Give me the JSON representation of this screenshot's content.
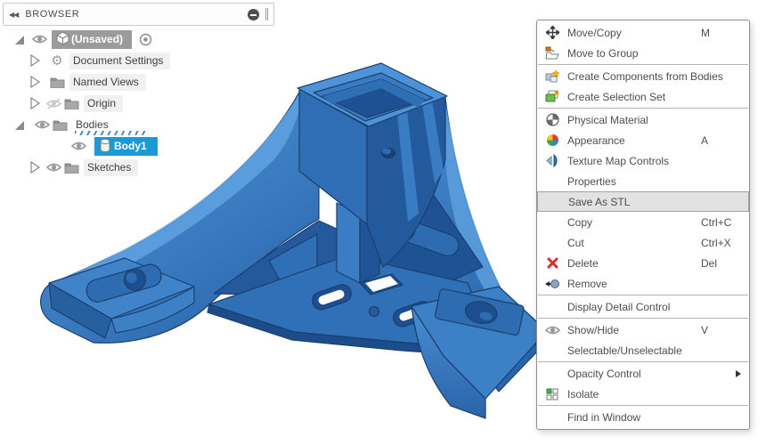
{
  "browser_panel": {
    "title": "BROWSER",
    "header_icons": {
      "collapse": "double-left-arrows-icon",
      "minimize": "minus-circle-icon",
      "resize": "grip-handle-icon"
    },
    "tree": [
      {
        "label": "(Unsaved)",
        "icon": "component-cube-icon",
        "expanded": true,
        "visible": true,
        "selected": "gray",
        "extra": "activate-radio-icon"
      },
      {
        "label": "Document Settings",
        "icon": "gear-icon",
        "expanded": false
      },
      {
        "label": "Named Views",
        "icon": "folder-icon",
        "expanded": false
      },
      {
        "label": "Origin",
        "icon": "folder-icon",
        "expanded": false,
        "visible": false
      },
      {
        "label": "Bodies",
        "icon": "folder-icon",
        "expanded": true,
        "visible": true,
        "child_selected_hatch": true
      },
      {
        "label": "Body1",
        "icon": "body-cylinder-icon",
        "visible": true,
        "selected": "blue"
      },
      {
        "label": "Sketches",
        "icon": "folder-icon",
        "expanded": false,
        "visible": true
      }
    ],
    "gear_glyph": "⚙"
  },
  "context_menu": {
    "items": [
      {
        "label": "Move/Copy",
        "shortcut": "M",
        "icon": "move-arrows-icon"
      },
      {
        "label": "Move to Group",
        "icon": "move-to-group-folder-icon",
        "separator_after": true
      },
      {
        "label": "Create Components from Bodies",
        "icon": "create-components-icon"
      },
      {
        "label": "Create Selection Set",
        "icon": "selection-set-icon",
        "separator_after": true
      },
      {
        "label": "Physical Material",
        "icon": "material-sphere-icon"
      },
      {
        "label": "Appearance",
        "shortcut": "A",
        "icon": "color-wheel-icon"
      },
      {
        "label": "Texture Map Controls",
        "icon": "texture-map-icon"
      },
      {
        "label": "Properties"
      },
      {
        "label": "Save As STL",
        "highlighted": true
      },
      {
        "label": "Copy",
        "shortcut": "Ctrl+C"
      },
      {
        "label": "Cut",
        "shortcut": "Ctrl+X"
      },
      {
        "label": "Delete",
        "shortcut": "Del",
        "icon": "delete-x-icon"
      },
      {
        "label": "Remove",
        "icon": "remove-arrow-icon",
        "separator_after": true
      },
      {
        "label": "Display Detail Control",
        "separator_after": true
      },
      {
        "label": "Show/Hide",
        "shortcut": "V",
        "icon": "eye-icon"
      },
      {
        "label": "Selectable/Unselectable",
        "separator_after": true
      },
      {
        "label": "Opacity Control",
        "submenu": true
      },
      {
        "label": "Isolate",
        "icon": "isolate-grid-icon",
        "separator_after": true
      },
      {
        "label": "Find in Window"
      }
    ]
  },
  "model": {
    "body_name": "Body1",
    "description": "blue 3D-printed style corner bracket with square tube socket, three gusseted legs and perforated triangular base",
    "colors": {
      "face_main": "#2f6fb6",
      "face_light": "#4e92d7",
      "face_lighter": "#5fa2e0",
      "face_dark": "#235a9d",
      "face_darker": "#1d4e8e",
      "outline": "#1b4070",
      "selection_highlight": "#1a9ad6",
      "tree_selected_gray": "#9b9b9b"
    }
  }
}
